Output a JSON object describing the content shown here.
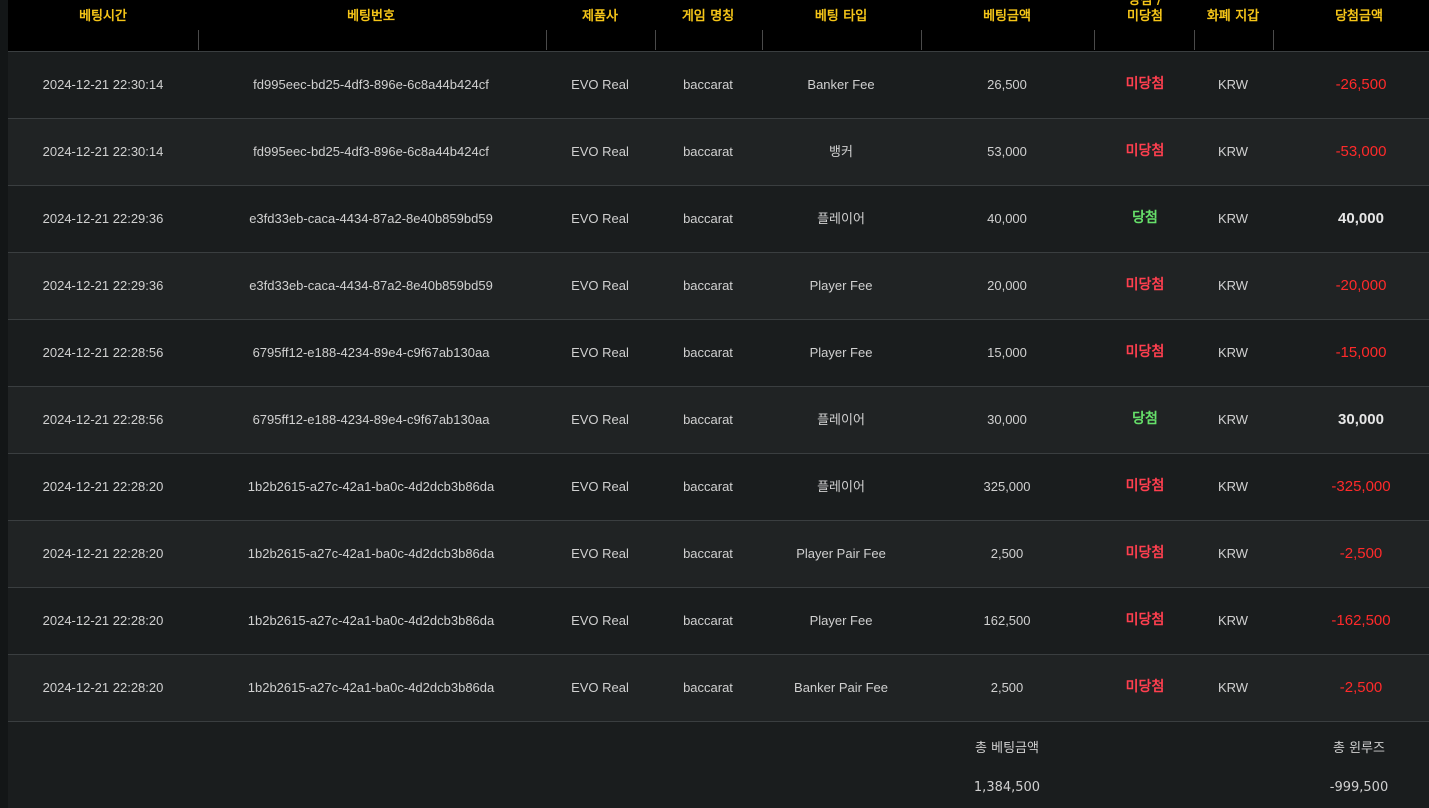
{
  "columns": [
    {
      "label": "베팅시간"
    },
    {
      "label": "베팅번호"
    },
    {
      "label": "제품사"
    },
    {
      "label": "게임 명칭"
    },
    {
      "label": "베팅 타입"
    },
    {
      "label": "베팅금액"
    },
    {
      "label_top": "당첨 /",
      "label": "미당첨"
    },
    {
      "label": "화폐 지갑"
    },
    {
      "label": "당첨금액"
    }
  ],
  "rows": [
    {
      "time": "2024-12-21 22:30:14",
      "bet_id": "fd995eec-bd25-4df3-896e-6c8a44b424cf",
      "provider": "EVO Real",
      "game": "baccarat",
      "bet_type": "Banker Fee",
      "amount": "26,500",
      "status": "미당첨",
      "currency": "KRW",
      "win_amount": "-26,500"
    },
    {
      "time": "2024-12-21 22:30:14",
      "bet_id": "fd995eec-bd25-4df3-896e-6c8a44b424cf",
      "provider": "EVO Real",
      "game": "baccarat",
      "bet_type": "뱅커",
      "amount": "53,000",
      "status": "미당첨",
      "currency": "KRW",
      "win_amount": "-53,000"
    },
    {
      "time": "2024-12-21 22:29:36",
      "bet_id": "e3fd33eb-caca-4434-87a2-8e40b859bd59",
      "provider": "EVO Real",
      "game": "baccarat",
      "bet_type": "플레이어",
      "amount": "40,000",
      "status": "당첨",
      "currency": "KRW",
      "win_amount": "40,000"
    },
    {
      "time": "2024-12-21 22:29:36",
      "bet_id": "e3fd33eb-caca-4434-87a2-8e40b859bd59",
      "provider": "EVO Real",
      "game": "baccarat",
      "bet_type": "Player Fee",
      "amount": "20,000",
      "status": "미당첨",
      "currency": "KRW",
      "win_amount": "-20,000"
    },
    {
      "time": "2024-12-21 22:28:56",
      "bet_id": "6795ff12-e188-4234-89e4-c9f67ab130aa",
      "provider": "EVO Real",
      "game": "baccarat",
      "bet_type": "Player Fee",
      "amount": "15,000",
      "status": "미당첨",
      "currency": "KRW",
      "win_amount": "-15,000"
    },
    {
      "time": "2024-12-21 22:28:56",
      "bet_id": "6795ff12-e188-4234-89e4-c9f67ab130aa",
      "provider": "EVO Real",
      "game": "baccarat",
      "bet_type": "플레이어",
      "amount": "30,000",
      "status": "당첨",
      "currency": "KRW",
      "win_amount": "30,000"
    },
    {
      "time": "2024-12-21 22:28:20",
      "bet_id": "1b2b2615-a27c-42a1-ba0c-4d2dcb3b86da",
      "provider": "EVO Real",
      "game": "baccarat",
      "bet_type": "플레이어",
      "amount": "325,000",
      "status": "미당첨",
      "currency": "KRW",
      "win_amount": "-325,000"
    },
    {
      "time": "2024-12-21 22:28:20",
      "bet_id": "1b2b2615-a27c-42a1-ba0c-4d2dcb3b86da",
      "provider": "EVO Real",
      "game": "baccarat",
      "bet_type": "Player Pair Fee",
      "amount": "2,500",
      "status": "미당첨",
      "currency": "KRW",
      "win_amount": "-2,500"
    },
    {
      "time": "2024-12-21 22:28:20",
      "bet_id": "1b2b2615-a27c-42a1-ba0c-4d2dcb3b86da",
      "provider": "EVO Real",
      "game": "baccarat",
      "bet_type": "Player Fee",
      "amount": "162,500",
      "status": "미당첨",
      "currency": "KRW",
      "win_amount": "-162,500"
    },
    {
      "time": "2024-12-21 22:28:20",
      "bet_id": "1b2b2615-a27c-42a1-ba0c-4d2dcb3b86da",
      "provider": "EVO Real",
      "game": "baccarat",
      "bet_type": "Banker Pair Fee",
      "amount": "2,500",
      "status": "미당첨",
      "currency": "KRW",
      "win_amount": "-2,500"
    }
  ],
  "summary": {
    "total_bet_label": "총 베팅금액",
    "total_bet_value": "1,384,500",
    "total_winloss_label": "총 윈루즈",
    "total_winloss_value": "-999,500"
  },
  "colors": {
    "header_text": "#f5c518",
    "lose": "#ff3f4f",
    "win": "#66e06a",
    "negative_amount": "#ff2a2a"
  }
}
